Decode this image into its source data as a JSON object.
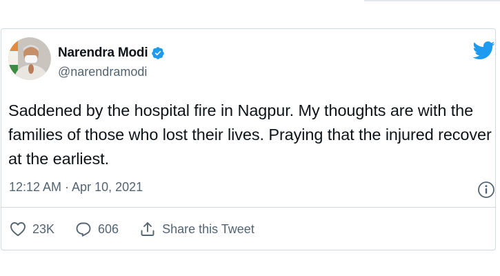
{
  "tweet": {
    "author_name": "Narendra Modi",
    "handle": "@narendramodi",
    "text": "Saddened by the hospital fire in Nagpur. My thoughts are with the families of those who lost their lives. Praying that the injured recover at the earliest.",
    "timestamp": "12:12 AM · Apr 10, 2021",
    "likes": "23K",
    "replies": "606",
    "share_label": "Share this Tweet"
  },
  "icons": {
    "verified": "verified-badge-icon",
    "brand": "twitter-bird-icon",
    "info": "info-icon",
    "like": "heart-icon",
    "reply": "reply-bubble-icon",
    "share": "share-upload-icon"
  },
  "colors": {
    "brand_blue": "#1d9bf0",
    "text_primary": "#0f1419",
    "text_secondary": "#536471",
    "border": "#cfd9de"
  }
}
